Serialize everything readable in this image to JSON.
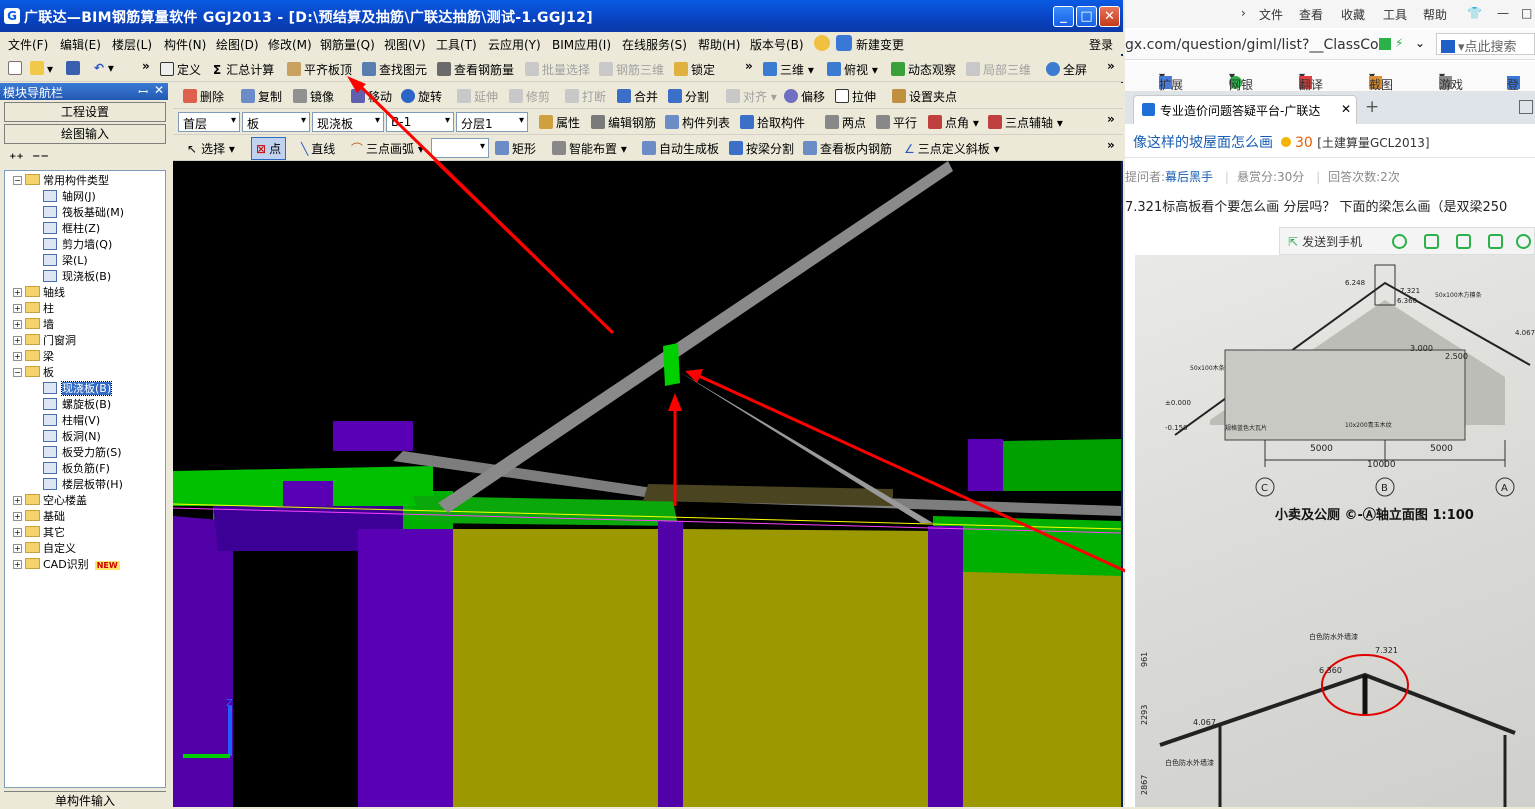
{
  "app": {
    "title": "广联达—BIM钢筋算量软件 GGJ2013 - [D:\\预结算及抽筋\\广联达抽筋\\测试-1.GGJ12]",
    "window_buttons": {
      "minimize": "_",
      "maximize": "□",
      "close": "✕"
    }
  },
  "menu": {
    "items": [
      "文件(F)",
      "编辑(E)",
      "楼层(L)",
      "构件(N)",
      "绘图(D)",
      "修改(M)",
      "钢筋量(Q)",
      "视图(V)",
      "工具(T)",
      "云应用(Y)",
      "BIM应用(I)",
      "在线服务(S)",
      "帮助(H)",
      "版本号(B)",
      "新建变更"
    ],
    "login": "登录"
  },
  "toolbar1": {
    "define": "定义",
    "sum": "汇总计算",
    "align_top": "平齐板顶",
    "find": "查找图元",
    "view_rebar": "查看钢筋量",
    "batch": "批量选择",
    "rebar3d": "钢筋三维",
    "lock": "锁定",
    "three_d": "三维",
    "top_view": "俯视",
    "dynamic": "动态观察",
    "local3d": "局部三维",
    "fullscreen": "全屏"
  },
  "toolbar2": {
    "delete": "删除",
    "copy": "复制",
    "mirror": "镜像",
    "move": "移动",
    "rotate": "旋转",
    "extend": "延伸",
    "trim": "修剪",
    "break": "打断",
    "merge": "合并",
    "split": "分割",
    "align": "对齐",
    "offset": "偏移",
    "stretch": "拉伸",
    "grip": "设置夹点"
  },
  "toolbar3": {
    "floor": "首层",
    "category": "板",
    "type": "现浇板",
    "name": "B-1",
    "layer": "分层1",
    "props": "属性",
    "edit_rebar": "编辑钢筋",
    "comp_list": "构件列表",
    "pick": "拾取构件",
    "two_points": "两点",
    "parallel": "平行",
    "point_angle": "点角",
    "three_point_axis": "三点辅轴"
  },
  "toolbar4": {
    "select": "选择",
    "point": "点",
    "line": "直线",
    "arc": "三点画弧",
    "rect": "矩形",
    "smart": "智能布置",
    "auto_gen": "自动生成板",
    "split_by_beam": "按梁分割",
    "view_inner": "查看板内钢筋",
    "three_point_slope": "三点定义斜板"
  },
  "nav": {
    "header": "模块导航栏",
    "pin": "ꟷ",
    "close": "✕",
    "btn_settings": "工程设置",
    "btn_drawing": "绘图输入",
    "tree": [
      {
        "label": "常用构件类型",
        "level": 0,
        "pm": "−",
        "folder": true
      },
      {
        "label": "轴网(J)",
        "level": 1
      },
      {
        "label": "筏板基础(M)",
        "level": 1
      },
      {
        "label": "框柱(Z)",
        "level": 1
      },
      {
        "label": "剪力墙(Q)",
        "level": 1
      },
      {
        "label": "梁(L)",
        "level": 1
      },
      {
        "label": "现浇板(B)",
        "level": 1
      },
      {
        "label": "轴线",
        "level": 0,
        "pm": "+",
        "folder": true
      },
      {
        "label": "柱",
        "level": 0,
        "pm": "+",
        "folder": true
      },
      {
        "label": "墙",
        "level": 0,
        "pm": "+",
        "folder": true
      },
      {
        "label": "门窗洞",
        "level": 0,
        "pm": "+",
        "folder": true
      },
      {
        "label": "梁",
        "level": 0,
        "pm": "+",
        "folder": true
      },
      {
        "label": "板",
        "level": 0,
        "pm": "−",
        "folder": true
      },
      {
        "label": "现浇板(B)",
        "level": 1,
        "selected": true
      },
      {
        "label": "螺旋板(B)",
        "level": 1
      },
      {
        "label": "柱帽(V)",
        "level": 1
      },
      {
        "label": "板洞(N)",
        "level": 1
      },
      {
        "label": "板受力筋(S)",
        "level": 1
      },
      {
        "label": "板负筋(F)",
        "level": 1
      },
      {
        "label": "楼层板带(H)",
        "level": 1
      },
      {
        "label": "空心楼盖",
        "level": 0,
        "pm": "+",
        "folder": true
      },
      {
        "label": "基础",
        "level": 0,
        "pm": "+",
        "folder": true
      },
      {
        "label": "其它",
        "level": 0,
        "pm": "+",
        "folder": true
      },
      {
        "label": "自定义",
        "level": 0,
        "pm": "+",
        "folder": true
      },
      {
        "label": "CAD识别",
        "level": 0,
        "pm": "+",
        "folder": true
      }
    ],
    "new_badge": "NEW",
    "bottom_tab": "单构件输入"
  },
  "browser": {
    "menu": [
      "文件",
      "查看",
      "收藏",
      "工具",
      "帮助"
    ],
    "url": "gx.com/question/giml/list?__ClassCo",
    "search_placeholder": "点此搜索",
    "bookmarks": [
      "扩展",
      "网银",
      "翻译",
      "截图",
      "游戏",
      "登"
    ],
    "tab_title": "专业造价问题答疑平台-广联达",
    "tab_close": "✕",
    "new_tab": "+",
    "question_title": "像这样的坡屋面怎么画",
    "reward": "30",
    "category": "[土建算量GCL2013]",
    "asker_label": "提问者:",
    "asker": "幕后黑手",
    "bounty": "悬赏分:30分",
    "answers": "回答次数:2次",
    "body": "7.321标高板看个要怎么画 分层吗？   下面的梁怎么画（是双梁250",
    "send_phone": "发送到手机"
  },
  "drawing": {
    "top_labels": [
      "7.321",
      "6.360",
      "6.248",
      "50x100木方檩条"
    ],
    "left_labels": [
      "4.067",
      "±0.000",
      "-0.150",
      "50x100木条"
    ],
    "dims": [
      "5000",
      "5000",
      "10000",
      "3.000",
      "2.500"
    ],
    "grid": [
      "C",
      "B",
      "A"
    ],
    "caption": "小卖及公厕 ©-Ⓐ轴立面图 1:100",
    "detail_labels": [
      "白色防水外墙漆",
      "7.321",
      "6.360",
      "4.067",
      "961",
      "2293",
      "2867",
      "白色防水外墙漆"
    ],
    "small_labels": [
      "规格蓝色大瓦片",
      "10x200青玉木纹"
    ]
  },
  "colors": {
    "accent_blue": "#0a5be5",
    "annotation_red": "#ff0000",
    "slab_yellow": "#9b9800",
    "column_purple": "#5200a8",
    "wall_green": "#00c000",
    "beam_gray": "#8c8c8c"
  }
}
